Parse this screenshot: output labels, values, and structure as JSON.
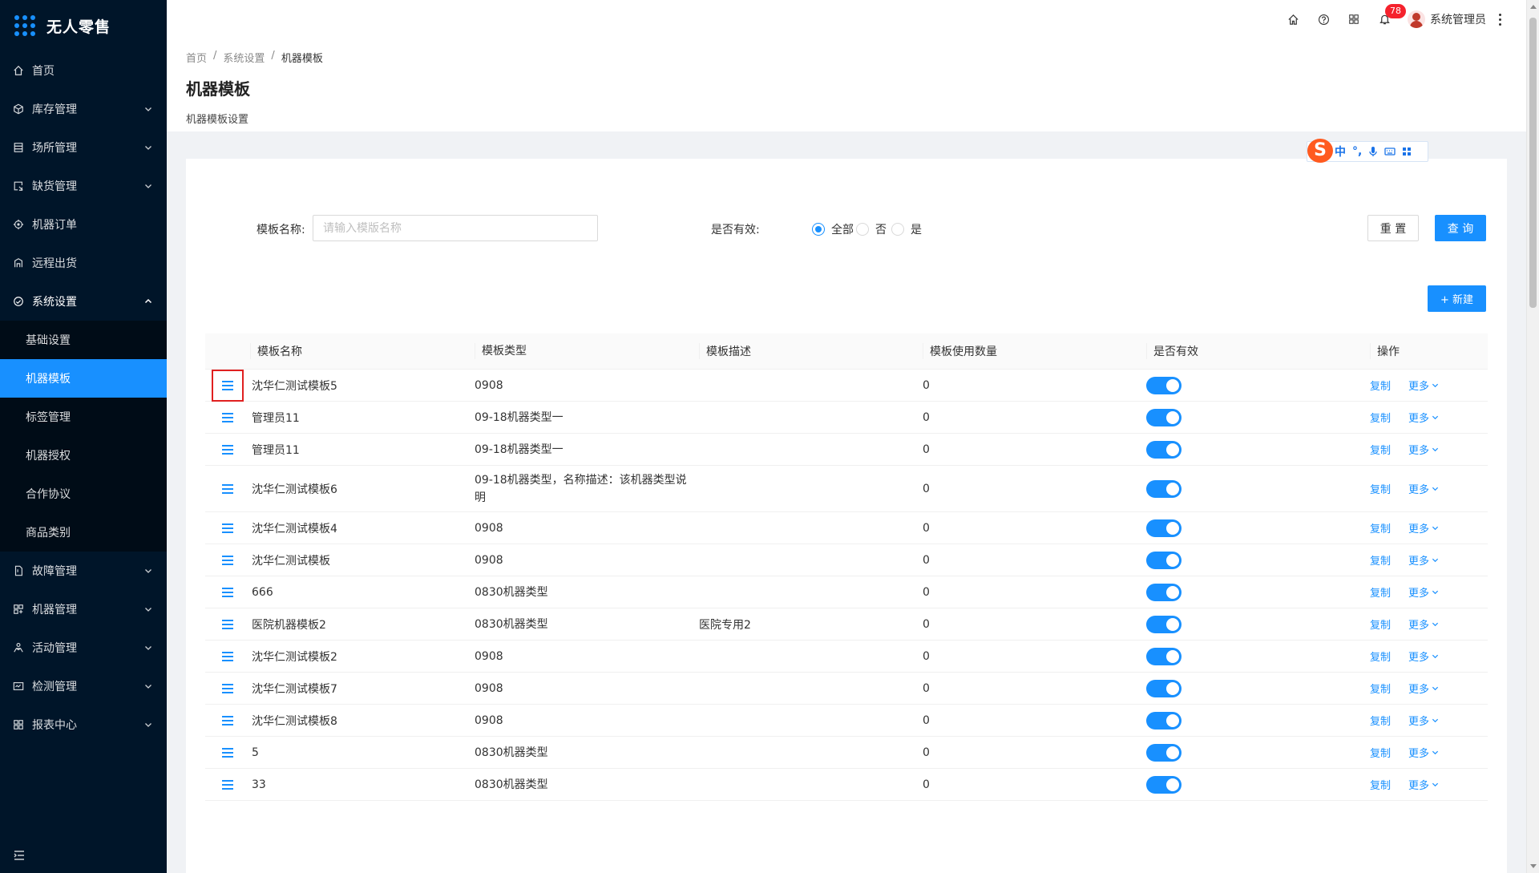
{
  "app": {
    "title": "无人零售"
  },
  "sidebar": {
    "menu": [
      {
        "key": "home",
        "label": "首页",
        "icon": "home-icon",
        "expandable": false
      },
      {
        "key": "inventory",
        "label": "库存管理",
        "icon": "box-icon",
        "expandable": true
      },
      {
        "key": "venue",
        "label": "场所管理",
        "icon": "building-icon",
        "expandable": true
      },
      {
        "key": "shortage",
        "label": "缺货管理",
        "icon": "shortage-icon",
        "expandable": true
      },
      {
        "key": "orders",
        "label": "机器订单",
        "icon": "order-icon",
        "expandable": false
      },
      {
        "key": "remote",
        "label": "远程出货",
        "icon": "remote-icon",
        "expandable": false
      },
      {
        "key": "settings",
        "label": "系统设置",
        "icon": "settings-icon",
        "expandable": true
      }
    ],
    "settings_sub": [
      {
        "label": "基础设置",
        "active": false
      },
      {
        "label": "机器模板",
        "active": true
      },
      {
        "label": "标签管理",
        "active": false
      },
      {
        "label": "机器授权",
        "active": false
      },
      {
        "label": "合作协议",
        "active": false
      },
      {
        "label": "商品类别",
        "active": false
      }
    ],
    "menu_after": [
      {
        "key": "fault",
        "label": "故障管理",
        "icon": "fault-icon"
      },
      {
        "key": "machine",
        "label": "机器管理",
        "icon": "machine-icon"
      },
      {
        "key": "activity",
        "label": "活动管理",
        "icon": "activity-icon"
      },
      {
        "key": "detect",
        "label": "检测管理",
        "icon": "detect-icon"
      },
      {
        "key": "report",
        "label": "报表中心",
        "icon": "report-icon"
      }
    ]
  },
  "topbar": {
    "notification_count": "78",
    "user_name": "系统管理员"
  },
  "breadcrumb": [
    "首页",
    "系统设置",
    "机器模板"
  ],
  "page": {
    "title": "机器模板",
    "description": "机器模板设置"
  },
  "ime": {
    "lang": "中"
  },
  "filter": {
    "name_label": "模板名称:",
    "name_placeholder": "请输入模版名称",
    "name_value": "",
    "valid_label": "是否有效:",
    "options": [
      {
        "label": "全部",
        "checked": true
      },
      {
        "label": "否",
        "checked": false
      },
      {
        "label": "是",
        "checked": false
      }
    ],
    "reset": "重 置",
    "query": "查 询",
    "create": "+ 新建"
  },
  "table": {
    "columns": [
      "模板名称",
      "模板类型",
      "模板描述",
      "模板使用数量",
      "是否有效",
      "操作"
    ],
    "rows": [
      {
        "name": "沈华仁测试模板5",
        "type": "0908",
        "desc": "",
        "count": "0",
        "valid": true,
        "highlight": true
      },
      {
        "name": "管理员11",
        "type": "09-18机器类型一",
        "desc": "",
        "count": "0",
        "valid": true
      },
      {
        "name": "管理员11",
        "type": "09-18机器类型一",
        "desc": "",
        "count": "0",
        "valid": true
      },
      {
        "name": "沈华仁测试模板6",
        "type": "09-18机器类型，名称描述：该机器类型说明",
        "desc": "",
        "count": "0",
        "valid": true,
        "tall": true
      },
      {
        "name": "沈华仁测试模板4",
        "type": "0908",
        "desc": "",
        "count": "0",
        "valid": true
      },
      {
        "name": "沈华仁测试模板",
        "type": "0908",
        "desc": "",
        "count": "0",
        "valid": true
      },
      {
        "name": "666",
        "type": "0830机器类型",
        "desc": "",
        "count": "0",
        "valid": true
      },
      {
        "name": "医院机器模板2",
        "type": "0830机器类型",
        "desc": "医院专用2",
        "count": "0",
        "valid": true
      },
      {
        "name": "沈华仁测试模板2",
        "type": "0908",
        "desc": "",
        "count": "0",
        "valid": true
      },
      {
        "name": "沈华仁测试模板7",
        "type": "0908",
        "desc": "",
        "count": "0",
        "valid": true
      },
      {
        "name": "沈华仁测试模板8",
        "type": "0908",
        "desc": "",
        "count": "0",
        "valid": true
      },
      {
        "name": "5",
        "type": "0830机器类型",
        "desc": "",
        "count": "0",
        "valid": true
      },
      {
        "name": "33",
        "type": "0830机器类型",
        "desc": "",
        "count": "0",
        "valid": true
      }
    ],
    "copy_label": "复制",
    "more_label": "更多"
  },
  "colors": {
    "primary": "#1890ff",
    "sidebar_bg": "#001529",
    "highlight_border": "#e02020"
  }
}
